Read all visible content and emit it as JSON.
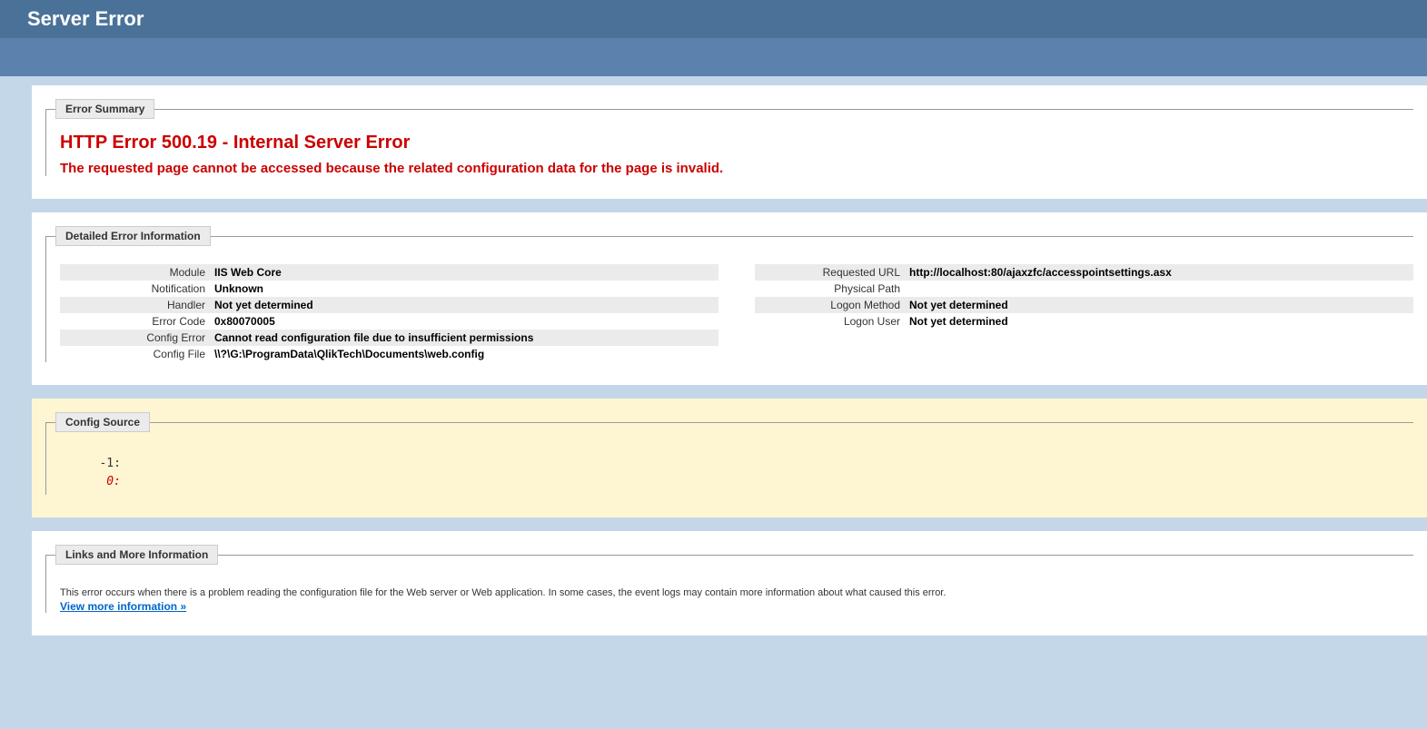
{
  "header": {
    "title": "Server Error"
  },
  "errorSummary": {
    "legend": "Error Summary",
    "title": "HTTP Error 500.19 - Internal Server Error",
    "subtitle": "The requested page cannot be accessed because the related configuration data for the page is invalid."
  },
  "detailedError": {
    "legend": "Detailed Error Information",
    "left": [
      {
        "label": "Module",
        "value": "IIS Web Core"
      },
      {
        "label": "Notification",
        "value": "Unknown"
      },
      {
        "label": "Handler",
        "value": "Not yet determined"
      },
      {
        "label": "Error Code",
        "value": "0x80070005"
      },
      {
        "label": "Config Error",
        "value": "Cannot read configuration file due to insufficient permissions"
      },
      {
        "label": "Config File",
        "value": "\\\\?\\G:\\ProgramData\\QlikTech\\Documents\\web.config"
      }
    ],
    "right": [
      {
        "label": "Requested URL",
        "value": "http://localhost:80/ajaxzfc/accesspointsettings.asx"
      },
      {
        "label": "Physical Path",
        "value": ""
      },
      {
        "label": "Logon Method",
        "value": "Not yet determined"
      },
      {
        "label": "Logon User",
        "value": "Not yet determined"
      }
    ]
  },
  "configSource": {
    "legend": "Config Source",
    "lines": [
      {
        "text": "   -1: ",
        "highlight": false
      },
      {
        "text": "    0: ",
        "highlight": true
      }
    ]
  },
  "linksInfo": {
    "legend": "Links and More Information",
    "text": "This error occurs when there is a problem reading the configuration file for the Web server or Web application. In some cases, the event logs may contain more information about what caused this error.",
    "linkText": "View more information »"
  }
}
